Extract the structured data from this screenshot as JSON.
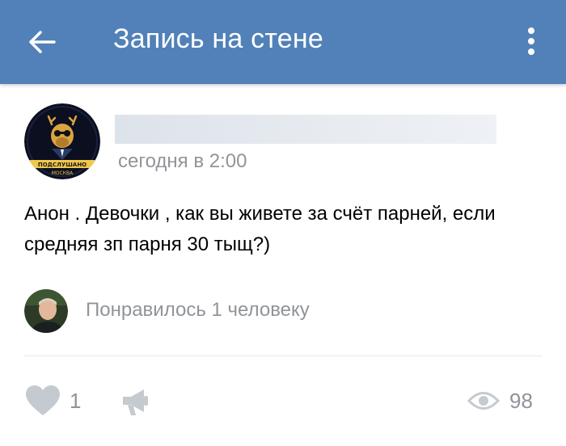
{
  "header": {
    "title": "Запись на стене"
  },
  "post": {
    "author_logo_text_top": "ПОДСЛУШАНО",
    "author_logo_text_bottom": "МОСКВА",
    "time": "сегодня в 2:00",
    "text": "Анон . Девочки , как вы живете за счёт парней, если средняя зп парня 30 тыщ?)"
  },
  "likes_row": {
    "text": "Понравилось 1 человеку"
  },
  "actions": {
    "like_count": "1",
    "views_count": "98"
  },
  "colors": {
    "header_bg": "#5181b8",
    "secondary_text": "#909499",
    "icon_gray": "#c5cad0"
  }
}
